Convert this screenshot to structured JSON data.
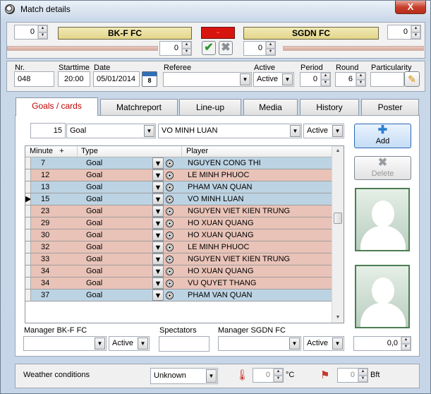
{
  "window": {
    "title": "Match details",
    "close": "X"
  },
  "score": {
    "home_goals": "0",
    "away_goals": "0",
    "home_team": "BK-F FC",
    "away_team": "SGDN FC",
    "flag_text": "~",
    "home_extra": "0",
    "away_extra": "0"
  },
  "meta": {
    "nr_label": "Nr.",
    "nr": "048",
    "starttime_label": "Starttime",
    "starttime": "20:00",
    "date_label": "Date",
    "date": "05/01/2014",
    "cal_day": "8",
    "referee_label": "Referee",
    "referee": "",
    "active_label": "Active",
    "active": "Active",
    "period_label": "Period",
    "period": "0",
    "round_label": "Round",
    "round": "6",
    "particularity_label": "Particularity",
    "particularity": ""
  },
  "tabs": [
    "Goals / cards",
    "Matchreport",
    "Line-up",
    "Media",
    "History",
    "Poster"
  ],
  "entry": {
    "minute": "15",
    "type": "Goal",
    "player": "VO MINH LUAN",
    "status": "Active"
  },
  "buttons": {
    "add": "Add",
    "delete": "Delete"
  },
  "grid": {
    "columns": [
      "Minute",
      "+",
      "Type",
      "Player"
    ],
    "rows": [
      {
        "minute": "7",
        "type": "Goal",
        "player": "NGUYEN CONG THI",
        "color": "blue",
        "current": false
      },
      {
        "minute": "12",
        "type": "Goal",
        "player": "LE MINH PHUOC",
        "color": "pink",
        "current": false
      },
      {
        "minute": "13",
        "type": "Goal",
        "player": "PHAM VAN QUAN",
        "color": "blue",
        "current": false
      },
      {
        "minute": "15",
        "type": "Goal",
        "player": "VO MINH LUAN",
        "color": "blue",
        "current": true
      },
      {
        "minute": "23",
        "type": "Goal",
        "player": "NGUYEN VIET KIEN TRUNG",
        "color": "pink",
        "current": false
      },
      {
        "minute": "29",
        "type": "Goal",
        "player": "HO XUAN QUANG",
        "color": "pink",
        "current": false
      },
      {
        "minute": "30",
        "type": "Goal",
        "player": "HO XUAN QUANG",
        "color": "pink",
        "current": false
      },
      {
        "minute": "32",
        "type": "Goal",
        "player": "LE MINH PHUOC",
        "color": "pink",
        "current": false
      },
      {
        "minute": "33",
        "type": "Goal",
        "player": "NGUYEN VIET KIEN TRUNG",
        "color": "pink",
        "current": false
      },
      {
        "minute": "34",
        "type": "Goal",
        "player": "HO XUAN QUANG",
        "color": "pink",
        "current": false
      },
      {
        "minute": "34",
        "type": "Goal",
        "player": "VU QUYET THANG",
        "color": "pink",
        "current": false
      },
      {
        "minute": "37",
        "type": "Goal",
        "player": "PHAM VAN QUAN",
        "color": "blue",
        "current": false
      }
    ]
  },
  "managers": {
    "home_label": "Manager BK-F FC",
    "home": "",
    "home_status": "Active",
    "spectators_label": "Spectators",
    "spectators": "",
    "away_label": "Manager SGDN FC",
    "away": "",
    "away_status": "Active",
    "rating": "0,0"
  },
  "weather": {
    "label": "Weather conditions",
    "value": "Unknown",
    "temp": "0",
    "temp_unit": "°C",
    "wind": "0",
    "wind_unit": "Bft"
  }
}
